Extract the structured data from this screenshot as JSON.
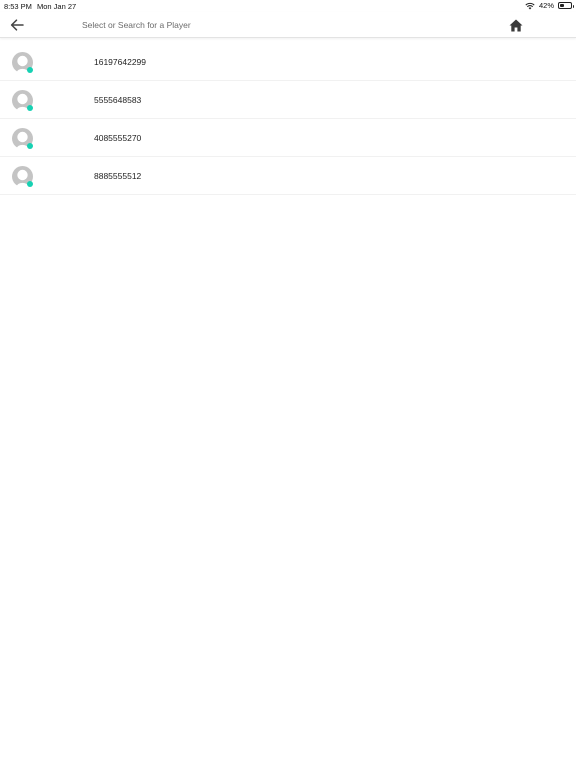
{
  "status_bar": {
    "time": "8:53 PM",
    "date": "Mon Jan 27",
    "battery_percent": "42%",
    "battery_level": 0.42
  },
  "nav": {
    "back_icon": "arrow-left-icon",
    "search_placeholder": "Select or Search for a Player",
    "home_icon": "home-icon"
  },
  "colors": {
    "online": "#16d1b3",
    "avatar": "#c4c4c4"
  },
  "players": [
    {
      "name": "16197642299",
      "online": true
    },
    {
      "name": "5555648583",
      "online": true
    },
    {
      "name": "4085555270",
      "online": true
    },
    {
      "name": "8885555512",
      "online": true
    }
  ]
}
